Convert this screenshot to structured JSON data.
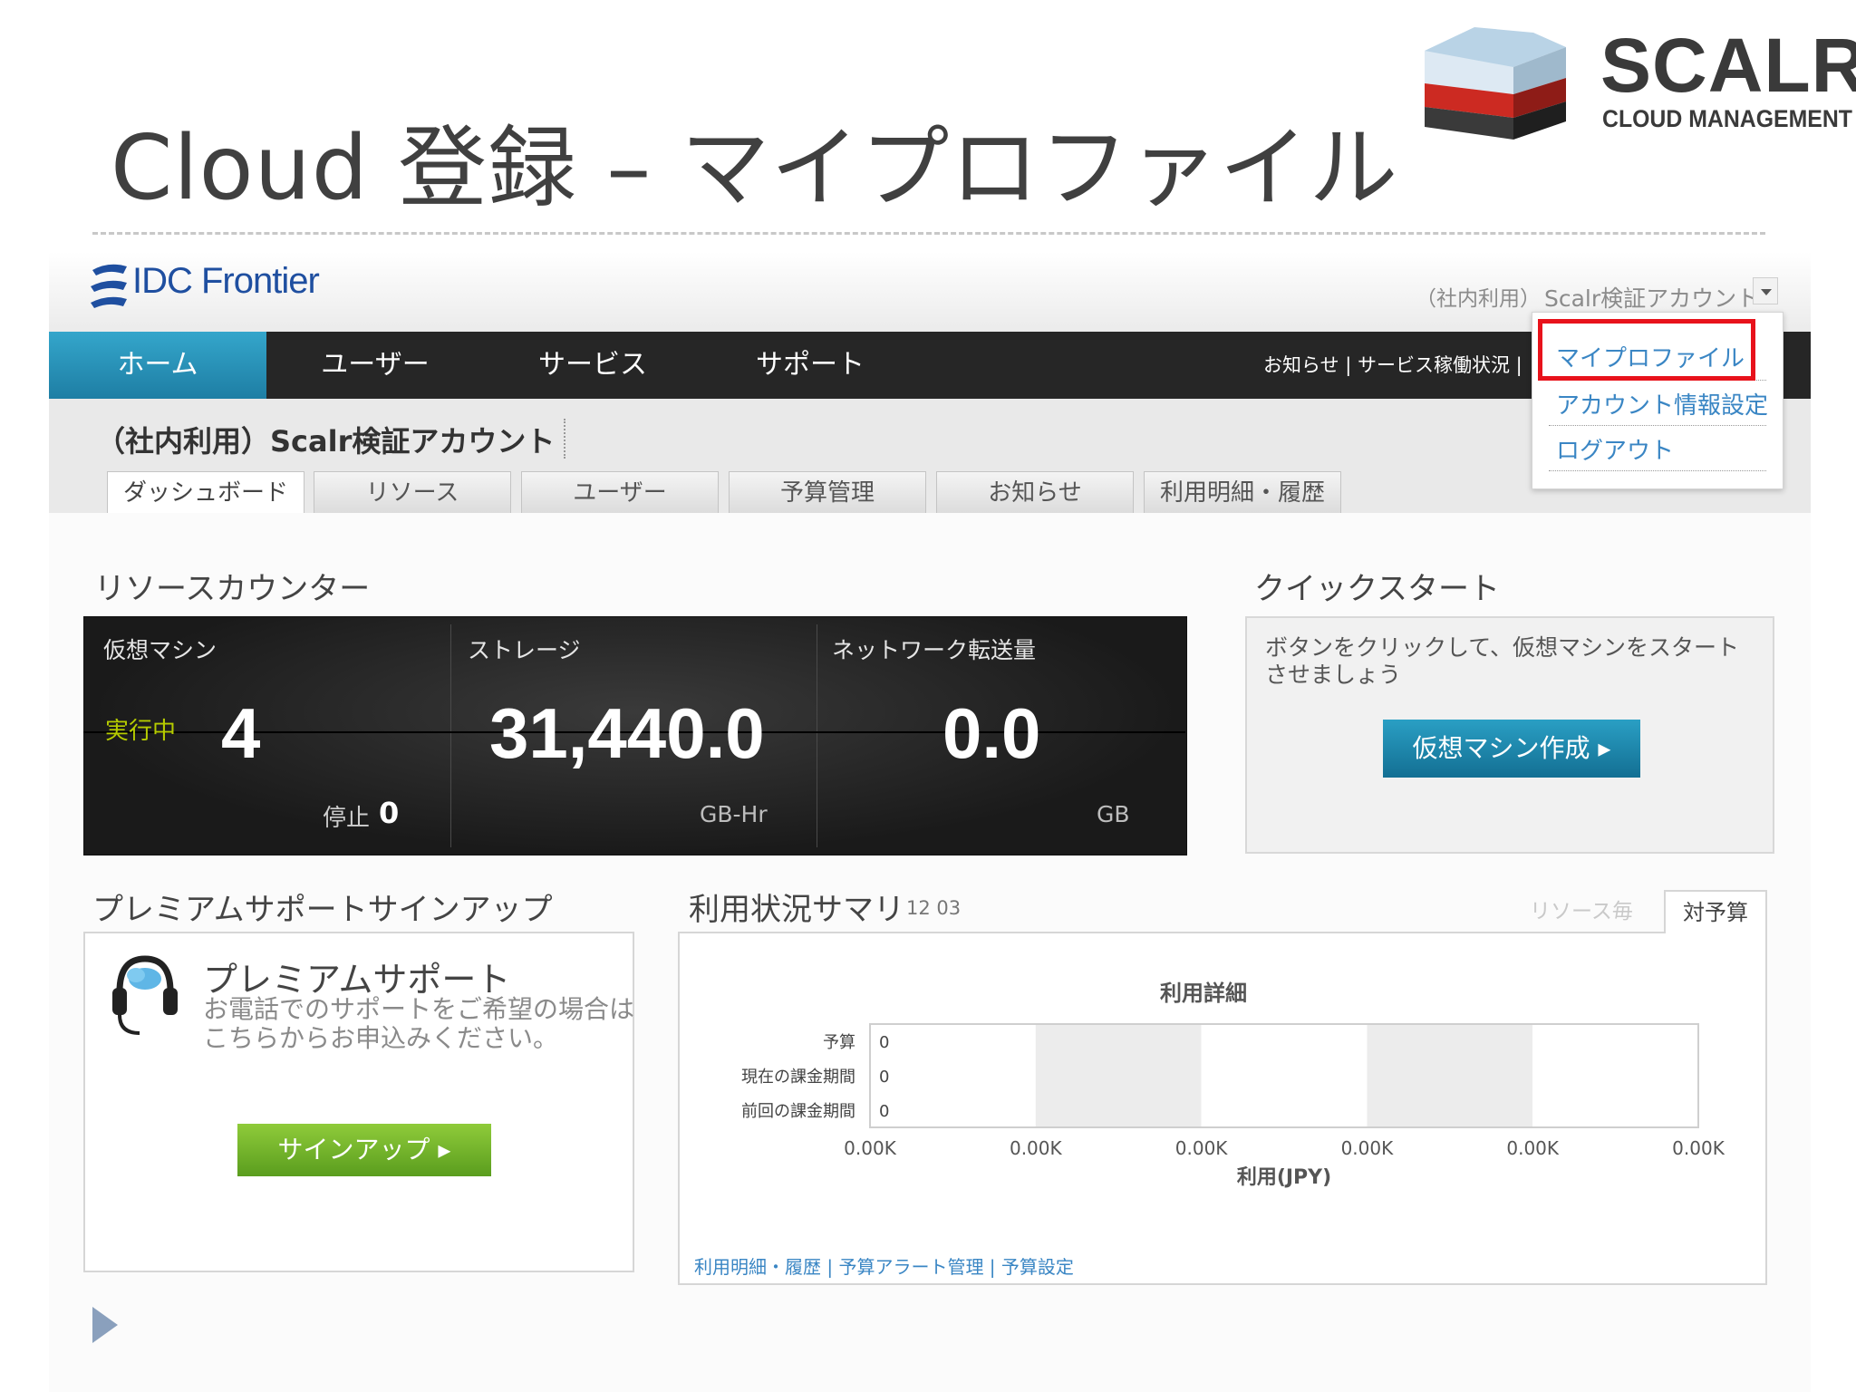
{
  "slide": {
    "title": "Cloud 登録 – マイプロファイル",
    "brand_name": "SCALR",
    "brand_sub": "CLOUD MANAGEMENT"
  },
  "app": {
    "logo_text": "IDC Frontier",
    "account_env": "（社内利用）",
    "account_name": "Scalr検証アカウント",
    "nav": {
      "items": [
        "ホーム",
        "ユーザー",
        "サービス",
        "サポート"
      ],
      "right_links": "お知らせ | サービス稼働状況 |"
    },
    "dropdown": {
      "items": [
        "マイプロファイル",
        "アカウント情報設定",
        "ログアウト"
      ]
    },
    "account_heading": "（社内利用）Scalr検証アカウント",
    "subtabs": [
      "ダッシュボード",
      "リソース",
      "ユーザー",
      "予算管理",
      "お知らせ",
      "利用明細・履歴"
    ]
  },
  "resource_counter": {
    "title": "リソースカウンター",
    "vm": {
      "label": "仮想マシン",
      "running_label": "実行中",
      "running": "4",
      "stopped_label": "停止",
      "stopped": "0"
    },
    "storage": {
      "label": "ストレージ",
      "value": "31,440.0",
      "unit": "GB-Hr"
    },
    "network": {
      "label": "ネットワーク転送量",
      "value": "0.0",
      "unit": "GB"
    }
  },
  "quick_start": {
    "title": "クイックスタート",
    "text": "ボタンをクリックして、仮想マシンをスタートさせましょう",
    "button": "仮想マシン作成 ▸"
  },
  "premium": {
    "section_title": "プレミアムサポートサインアップ",
    "title": "プレミアムサポート",
    "desc": "お電話でのサポートをご希望の場合はこちらからお申込みください。",
    "button": "サインアップ ▸"
  },
  "usage": {
    "title": "利用状況サマリ",
    "date": "12 03",
    "tab_inactive": "リソース毎",
    "tab_active": "対予算",
    "footer": "利用明細・履歴 | 予算アラート管理 | 予算設定"
  },
  "chart_data": {
    "type": "bar",
    "orientation": "horizontal",
    "title": "利用詳細",
    "categories": [
      "予算",
      "現在の課金期間",
      "前回の課金期間"
    ],
    "values": [
      0,
      0,
      0
    ],
    "data_labels": [
      "0",
      "0",
      "0"
    ],
    "x_ticks": [
      "0.00K",
      "0.00K",
      "0.00K",
      "0.00K",
      "0.00K",
      "0.00K"
    ],
    "xlabel": "利用(JPY)",
    "colors": {
      "band_light": "#ffffff",
      "band_dark": "#ececec"
    }
  }
}
